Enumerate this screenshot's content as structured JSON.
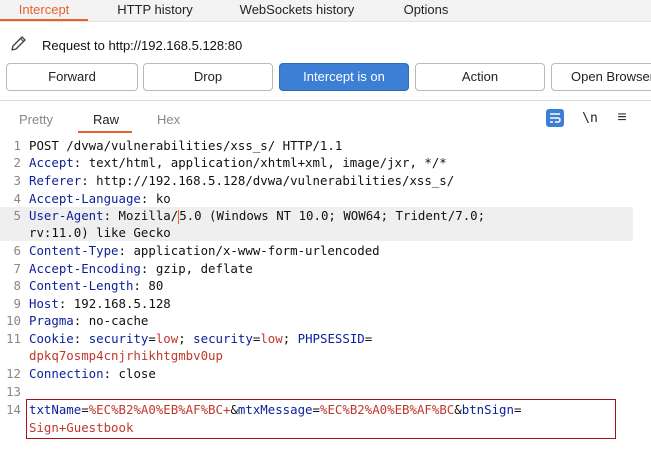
{
  "top_tabs": [
    {
      "label": "Intercept",
      "active": true
    },
    {
      "label": "HTTP history",
      "active": false
    },
    {
      "label": "WebSockets history",
      "active": false
    },
    {
      "label": "Options",
      "active": false
    }
  ],
  "request_line": {
    "icon": "pencil-icon",
    "label": "Request to http://192.168.5.128:80"
  },
  "buttons": {
    "forward": "Forward",
    "drop": "Drop",
    "intercept": "Intercept is on",
    "action": "Action",
    "open_browser": "Open Browser"
  },
  "editor_tabs": [
    {
      "label": "Pretty",
      "active": false
    },
    {
      "label": "Raw",
      "active": true
    },
    {
      "label": "Hex",
      "active": false
    }
  ],
  "editor_toolbar": {
    "wrap_icon": "wrap-lines-icon",
    "newline_label": "\\n",
    "menu_icon": "hamburger-menu-icon",
    "menu_glyph": "≡"
  },
  "colors": {
    "accent": "#e8602c",
    "primary_button": "#3d7fd4",
    "header_key": "#0b1f9a",
    "value_red": "#c0392b",
    "highlight_box": "#a31515"
  },
  "request": {
    "line1": "POST /dvwa/vulnerabilities/xss_s/ HTTP/1.1",
    "headers": [
      {
        "num": "2",
        "key": "Accept",
        "value": " text/html, application/xhtml+xml, image/jxr, */*"
      },
      {
        "num": "3",
        "key": "Referer",
        "value": " http://192.168.5.128/dvwa/vulnerabilities/xss_s/"
      },
      {
        "num": "4",
        "key": "Accept-Language",
        "value": " ko"
      },
      {
        "num": "6",
        "key": "Content-Type",
        "value": " application/x-www-form-urlencoded"
      },
      {
        "num": "7",
        "key": "Accept-Encoding",
        "value": " gzip, deflate"
      },
      {
        "num": "8",
        "key": "Content-Length",
        "value": " 80"
      },
      {
        "num": "9",
        "key": "Host",
        "value": " 192.168.5.128"
      },
      {
        "num": "10",
        "key": "Pragma",
        "value": " no-cache"
      },
      {
        "num": "12",
        "key": "Connection",
        "value": " close"
      }
    ],
    "user_agent": {
      "num": "5",
      "key": "User-Agent",
      "value_a": " Mozilla/",
      "value_b": "5.0 (Windows NT 10.0; WOW64; Trident/7.0;",
      "value_cont": "rv:11.0) like Gecko"
    },
    "cookie": {
      "num": "11",
      "key": "Cookie",
      "sep": ": ",
      "k1": "security",
      "v1": "low",
      "k2": "security",
      "v2": "low",
      "k3": "PHPSESSID",
      "v3_cont": "dpkq7osmp4cnjrhikhtgmbv0up"
    },
    "empty_line": "13",
    "body": {
      "num": "14",
      "p1k": "txtName",
      "p1v": "%EC%B2%A0%EB%AF%BC+",
      "p2k": "mtxMessage",
      "p2v": "%EC%B2%A0%EB%AF%BC",
      "p3k": "btnSign",
      "p3v_cont": "Sign+Guestbook"
    }
  },
  "line_numbers": {
    "l1": "1"
  }
}
